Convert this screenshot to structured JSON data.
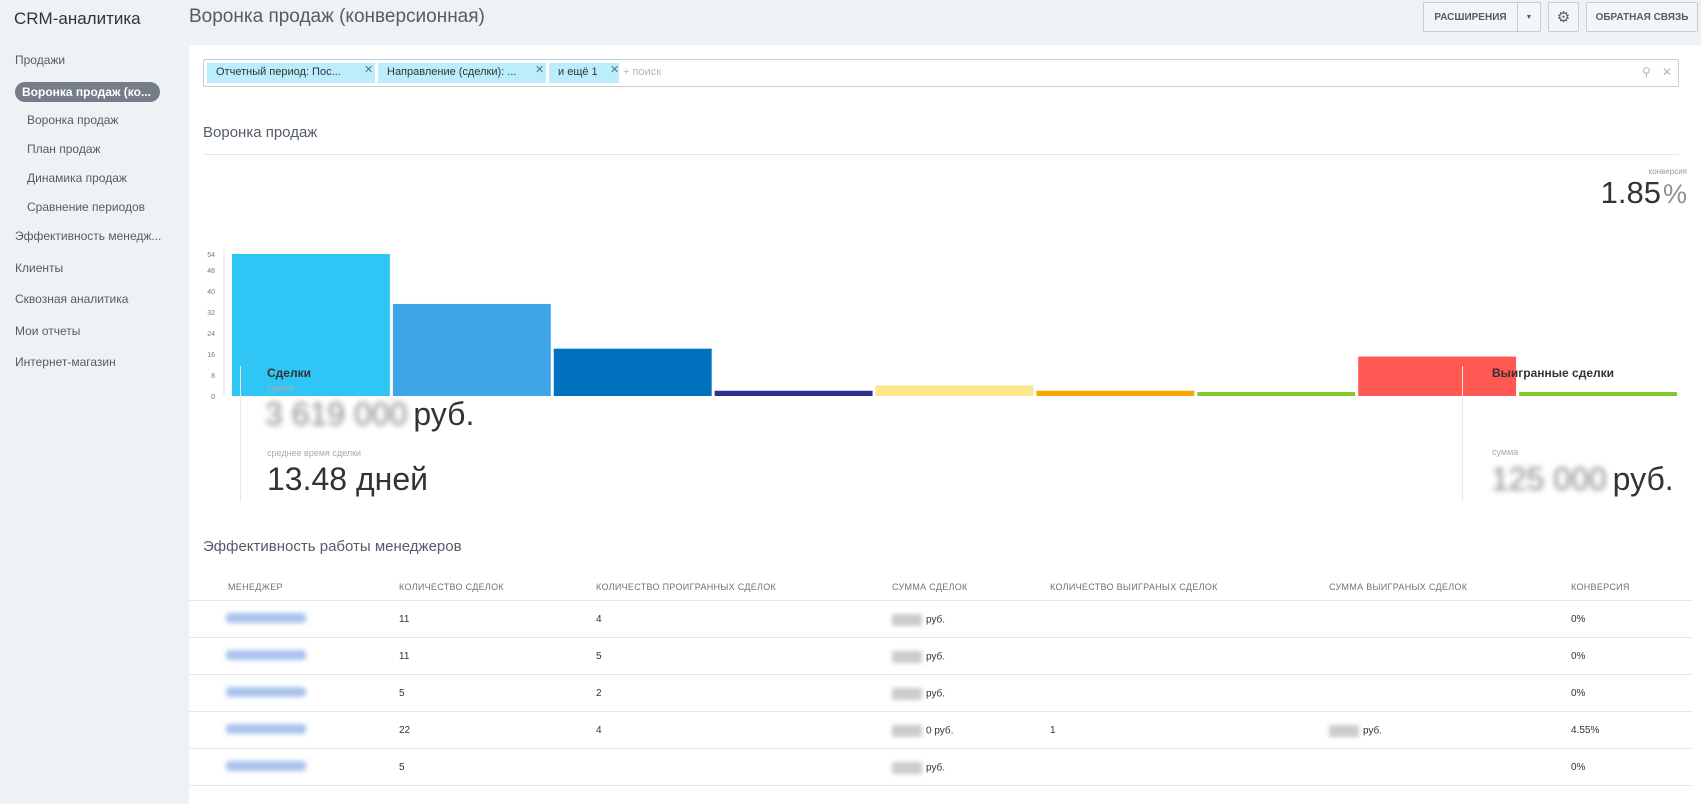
{
  "app": {
    "brand": "CRM-аналитика",
    "page_title": "Воронка продаж (конверсионная)"
  },
  "header": {
    "extensions_label": "РАСШИРЕНИЯ",
    "feedback_label": "ОБРАТНАЯ СВЯЗЬ"
  },
  "sidebar": {
    "items": [
      {
        "label": "Продажи"
      },
      {
        "label": "Воронка продаж (ко..."
      },
      {
        "label": "Воронка продаж"
      },
      {
        "label": "План продаж"
      },
      {
        "label": "Динамика продаж"
      },
      {
        "label": "Сравнение периодов"
      },
      {
        "label": "Эффективность менедж..."
      },
      {
        "label": "Клиенты"
      },
      {
        "label": "Сквозная аналитика"
      },
      {
        "label": "Мои отчеты"
      },
      {
        "label": "Интернет-магазин"
      }
    ]
  },
  "filter": {
    "chips": [
      {
        "label": "Отчетный период: Пос..."
      },
      {
        "label": "Направление (сделки): ..."
      },
      {
        "label": "и ещё 1"
      }
    ],
    "search_placeholder": "+ поиск"
  },
  "funnel": {
    "title": "Воронка продаж",
    "conversion_label": "конверсия",
    "conversion_value": "1.85",
    "conversion_unit": "%",
    "deals_title": "Сделки",
    "sum_label": "сумма",
    "deals_sum": "3 619 000",
    "currency": "руб.",
    "avg_time_label": "среднее время сделки",
    "avg_time_value": "13.48 дней",
    "won_title": "Выигранные сделки",
    "won_sum_label": "сумма",
    "won_sum": "125 000"
  },
  "chart_data": {
    "type": "bar",
    "yticks": [
      0,
      8,
      16,
      24,
      32,
      40,
      48,
      54
    ],
    "ylim": [
      0,
      54
    ],
    "values": [
      54,
      35,
      18,
      2,
      4,
      2,
      1.5,
      15,
      1.5
    ],
    "colors": [
      "#2fc6f6",
      "#3da5e8",
      "#0071bd",
      "#2e3192",
      "#fde68c",
      "#f7a700",
      "#7fc92b",
      "#ff5752",
      "#7fc92b"
    ]
  },
  "managers": {
    "title": "Эффективность работы менеджеров",
    "columns": [
      "МЕНЕДЖЕР",
      "КОЛИЧЕСТВО СДЕЛОК",
      "КОЛИЧЕСТВО ПРОИГРАННЫХ СДЕЛОК",
      "СУММА СДЕЛОК",
      "КОЛИЧЕСТВО ВЫИГРАНЫХ СДЕЛОК",
      "СУММА ВЫИГРАНЫХ СДЕЛОК",
      "КОНВЕРСИЯ"
    ],
    "rows": [
      {
        "deals": "11",
        "lost": "4",
        "sum": "руб.",
        "won": "",
        "won_sum": "",
        "conversion": "0%"
      },
      {
        "deals": "11",
        "lost": "5",
        "sum": "руб.",
        "won": "",
        "won_sum": "",
        "conversion": "0%"
      },
      {
        "deals": "5",
        "lost": "2",
        "sum": "руб.",
        "won": "",
        "won_sum": "",
        "conversion": "0%"
      },
      {
        "deals": "22",
        "lost": "4",
        "sum": "0 руб.",
        "won": "1",
        "won_sum": "руб.",
        "conversion": "4.55%"
      },
      {
        "deals": "5",
        "lost": "",
        "sum": "руб.",
        "won": "",
        "won_sum": "",
        "conversion": "0%"
      }
    ]
  }
}
